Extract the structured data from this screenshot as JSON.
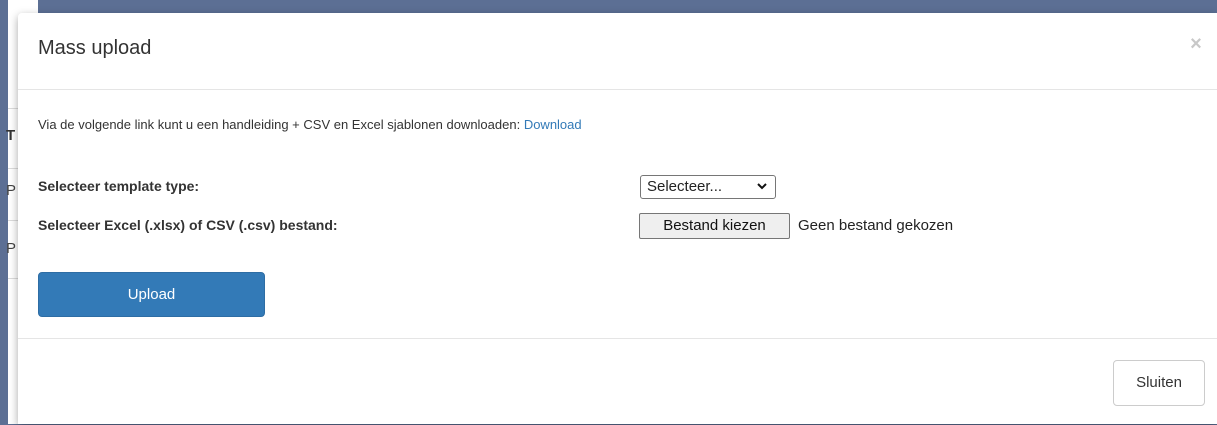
{
  "background": {
    "partial_texts": [
      "T",
      "P",
      "P"
    ]
  },
  "modal": {
    "title": "Mass upload",
    "close_glyph": "×",
    "intro_text": "Via de volgende link kunt u een handleiding + CSV en Excel sjablonen downloaden: ",
    "download_link": "Download",
    "template_label": "Selecteer template type:",
    "template_select_value": "Selecteer...",
    "file_label": "Selecteer Excel (.xlsx) of CSV (.csv) bestand:",
    "file_button_label": "Bestand kiezen",
    "file_status": "Geen bestand gekozen",
    "upload_label": "Upload",
    "footer_close_label": "Sluiten"
  },
  "colors": {
    "primary": "#337ab7",
    "link": "#337ab7",
    "overlay": "#5c6f94"
  },
  "icons": [
    "close-icon",
    "chevron-down-icon"
  ]
}
